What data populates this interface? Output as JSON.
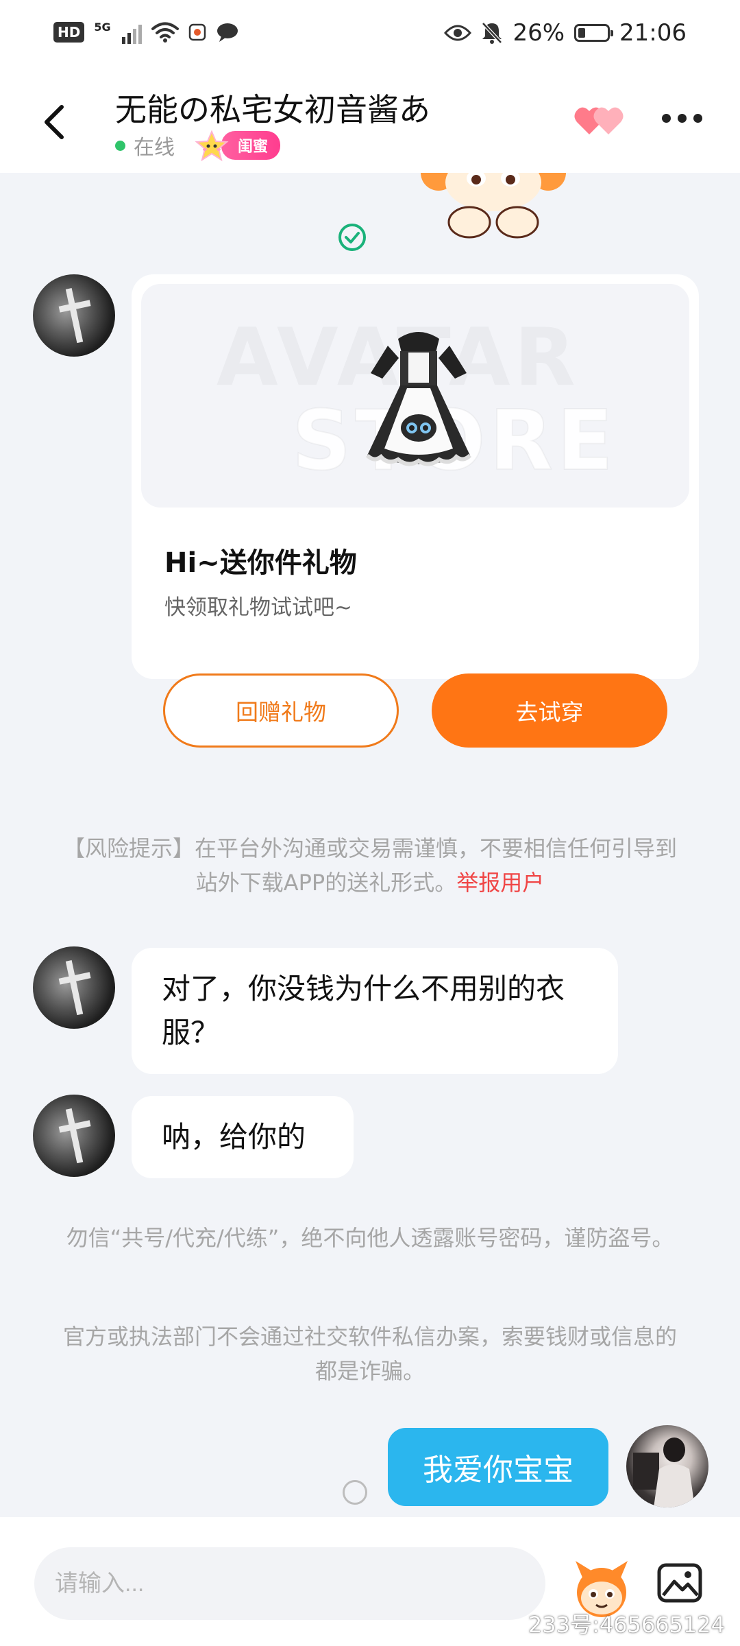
{
  "status_bar": {
    "hd": "HD",
    "network": "5G",
    "battery_text": "26%",
    "battery_level": 0.26,
    "time": "21:06",
    "icons": [
      "hd-icon",
      "signal-icon",
      "wifi-icon",
      "app-notification-icon",
      "chat-notification-icon",
      "eye-icon",
      "mute-bell-icon",
      "battery-icon"
    ]
  },
  "header": {
    "title": "无能の私宅女初音酱あ",
    "status": "在线",
    "relationship_tag": "闺蜜",
    "colors": {
      "online": "#2fc46a",
      "tag": "#ff3d8f"
    }
  },
  "messages": {
    "gift_card": {
      "title": "Hi~送你件礼物",
      "subtitle": "快领取礼物试试吧~",
      "watermark_line1": "AVATAR",
      "watermark_line2": "STORE",
      "return_gift_label": "回赠礼物",
      "try_on_label": "去试穿"
    },
    "risk_notice": {
      "text": "【风险提示】在平台外沟通或交易需谨慎，不要相信任何引导到站外下载APP的送礼形式。",
      "report_link": "举报用户"
    },
    "incoming_1": "对了，你没钱为什么不用别的衣服？",
    "incoming_2": "呐，给你的",
    "system_notice_1": "勿信“共号/代充/代练”，绝不向他人透露账号密码，谨防盗号。",
    "system_notice_2": "官方或执法部门不会通过社交软件私信办案，索要钱财或信息的都是诈骗。",
    "outgoing_1": "我爱你宝宝"
  },
  "input": {
    "placeholder": "请输入..."
  },
  "watermark": "233号:465665124",
  "colors": {
    "accent_orange": "#ff7514",
    "outgoing_bubble": "#2bb6ee",
    "report_red": "#f04545",
    "background": "#f2f4f8"
  }
}
